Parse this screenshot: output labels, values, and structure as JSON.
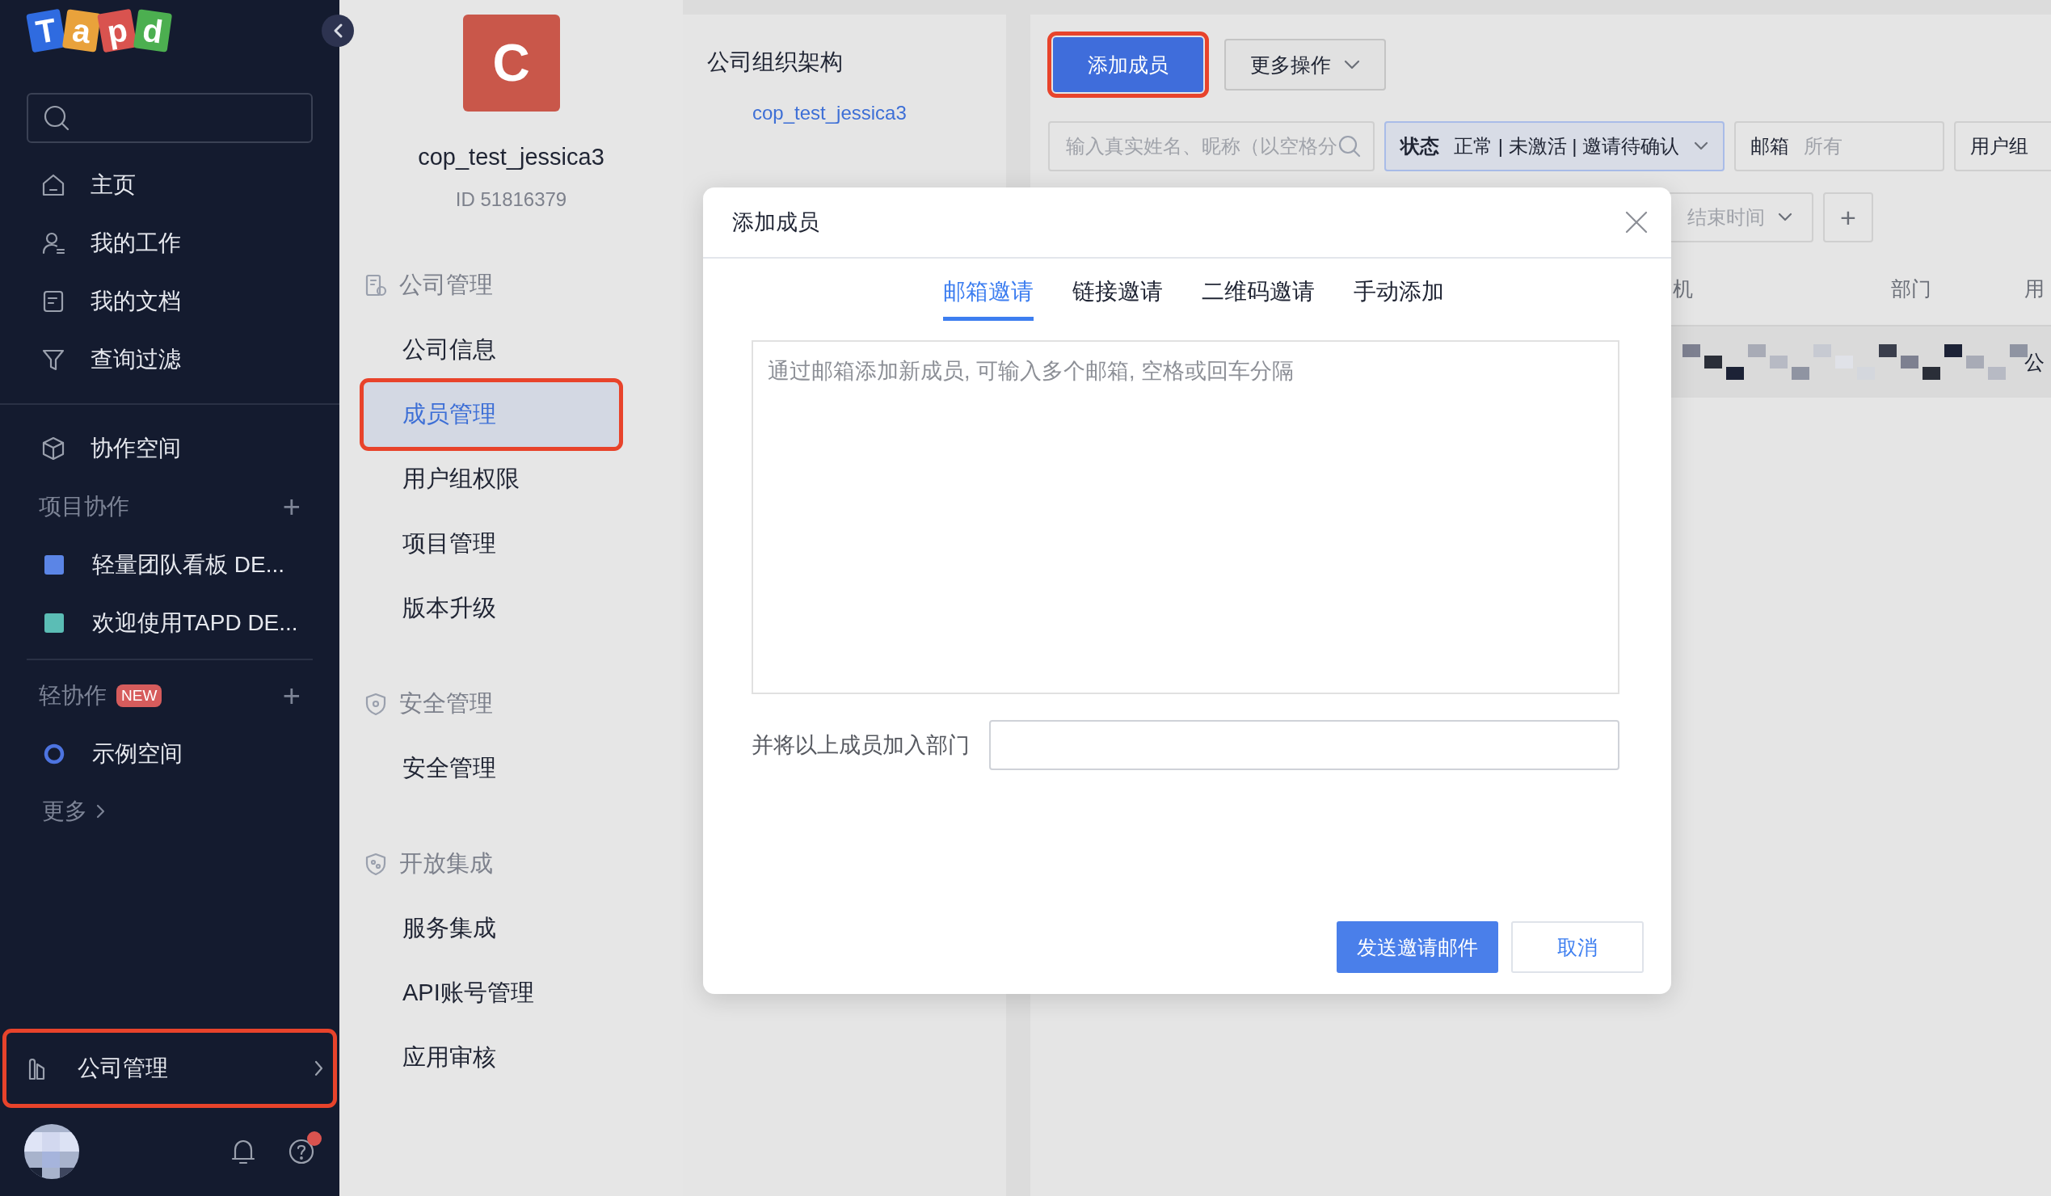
{
  "sidebar": {
    "logo": [
      {
        "letter": "T",
        "color": "#2f6be0"
      },
      {
        "letter": "a",
        "color": "#e9a23b"
      },
      {
        "letter": "p",
        "color": "#d9534f"
      },
      {
        "letter": "d",
        "color": "#4caf50"
      }
    ],
    "nav_items": [
      {
        "label": "主页"
      },
      {
        "label": "我的工作"
      },
      {
        "label": "我的文档"
      },
      {
        "label": "查询过滤"
      }
    ],
    "workspace": {
      "label": "协作空间"
    },
    "project_group": {
      "title": "项目协作",
      "add": "+"
    },
    "projects": [
      {
        "label": "轻量团队看板 DE...",
        "color": "#5b85e6"
      },
      {
        "label": "欢迎使用TAPD DE...",
        "color": "#5bbdb5"
      }
    ],
    "light_group": {
      "title": "轻协作",
      "badge": "NEW",
      "add": "+"
    },
    "spaces": [
      {
        "label": "示例空间"
      }
    ],
    "more": "更多",
    "company_admin": {
      "label": "公司管理",
      "highlighted": true
    },
    "help": {
      "notification": true
    }
  },
  "admin_menu": {
    "company": {
      "initial": "C",
      "name": "cop_test_jessica3",
      "id": "ID 51816379"
    },
    "sections": [
      {
        "title": "公司管理",
        "items": [
          {
            "label": "公司信息",
            "selected": false,
            "highlighted": false
          },
          {
            "label": "成员管理",
            "selected": true,
            "highlighted": true
          },
          {
            "label": "用户组权限",
            "selected": false,
            "highlighted": false
          },
          {
            "label": "项目管理",
            "selected": false,
            "highlighted": false
          },
          {
            "label": "版本升级",
            "selected": false,
            "highlighted": false
          }
        ]
      },
      {
        "title": "安全管理",
        "items": [
          {
            "label": "安全管理",
            "selected": false,
            "highlighted": false
          }
        ]
      },
      {
        "title": "开放集成",
        "items": [
          {
            "label": "服务集成",
            "selected": false,
            "highlighted": false
          },
          {
            "label": "API账号管理",
            "selected": false,
            "highlighted": false
          },
          {
            "label": "应用审核",
            "selected": false,
            "highlighted": false
          }
        ]
      }
    ]
  },
  "org_panel": {
    "title": "公司组织架构",
    "root": "cop_test_jessica3"
  },
  "members": {
    "add_button": {
      "label": "添加成员",
      "highlighted": true
    },
    "more_button": "更多操作",
    "search": {
      "placeholder": "输入真实姓名、昵称（以空格分"
    },
    "filters": [
      {
        "label": "状态",
        "value": "正常 | 未激活 | 邀请待确认",
        "active": true
      },
      {
        "label": "邮箱",
        "value": "所有",
        "active": false
      },
      {
        "label": "用户组",
        "active": false
      }
    ],
    "date_filter": "结束时间",
    "add_filter": "+",
    "table": {
      "columns": [
        {
          "label": "机"
        },
        {
          "label": "部门"
        },
        {
          "label": "用"
        }
      ],
      "rows": [
        {
          "column_3": "公"
        }
      ]
    }
  },
  "dialog": {
    "title": "添加成员",
    "tabs": [
      {
        "label": "邮箱邀请",
        "selected": true
      },
      {
        "label": "链接邀请",
        "selected": false
      },
      {
        "label": "二维码邀请",
        "selected": false
      },
      {
        "label": "手动添加",
        "selected": false
      }
    ],
    "emails": {
      "placeholder": "通过邮箱添加新成员, 可输入多个邮箱, 空格或回车分隔"
    },
    "department_label": "并将以上成员加入部门",
    "buttons": [
      {
        "label": "发送邀请邮件",
        "kind": "primary"
      },
      {
        "label": "取消",
        "kind": "secondary"
      }
    ]
  }
}
